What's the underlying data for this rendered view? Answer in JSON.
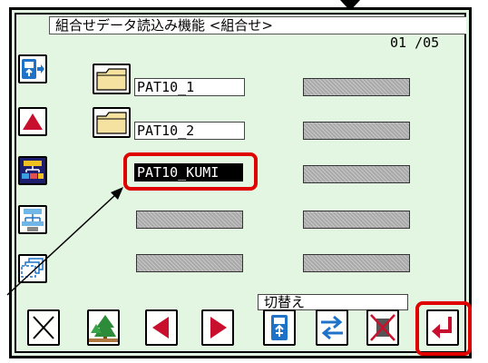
{
  "title": "組合せデータ読込み機能 <組合せ>",
  "page_indicator": "01 /05",
  "files": [
    {
      "name": "PAT10_1",
      "type": "folder"
    },
    {
      "name": "PAT10_2",
      "type": "folder"
    },
    {
      "name": "PAT10_KUMI",
      "type": "file",
      "selected": true
    }
  ],
  "switch_label": "切替え",
  "icons": {
    "side": [
      "usb-input-icon",
      "scroll-up-icon",
      "combination-pattern-icon",
      "pattern-load-icon",
      "copy-layers-icon"
    ],
    "bottom": [
      "cancel-x-icon",
      "tree-image-icon",
      "previous-icon",
      "next-icon",
      "usb-drive-icon",
      "swap-arrows-icon",
      "delete-disabled-icon",
      "enter-icon"
    ]
  },
  "colors": {
    "background": "#e3f6e1",
    "highlight": "#e00000",
    "accent_blue": "#1e73c8",
    "arrow_red": "#c8102e"
  }
}
